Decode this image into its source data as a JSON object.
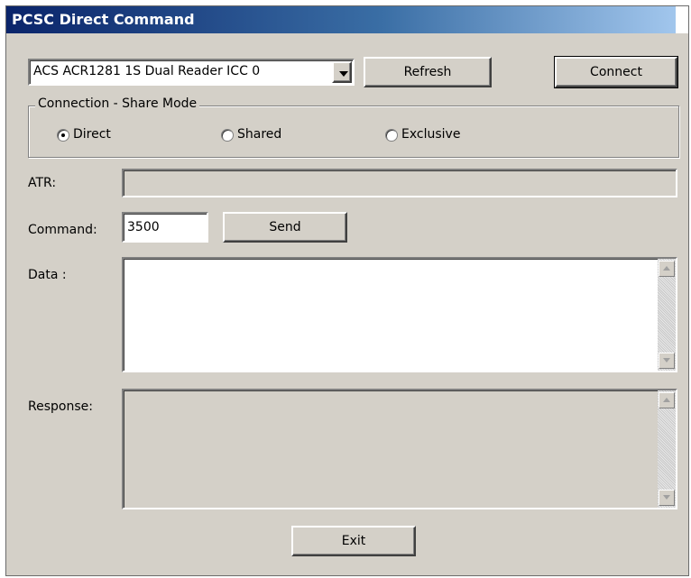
{
  "window": {
    "title": "PCSC Direct Command"
  },
  "reader": {
    "selected": "ACS ACR1281 1S Dual Reader ICC 0"
  },
  "buttons": {
    "refresh": "Refresh",
    "connect": "Connect",
    "send": "Send",
    "exit": "Exit"
  },
  "share_mode": {
    "legend": "Connection - Share Mode",
    "options": [
      {
        "label": "Direct",
        "selected": true
      },
      {
        "label": "Shared",
        "selected": false
      },
      {
        "label": "Exclusive",
        "selected": false
      }
    ]
  },
  "atr": {
    "label": "ATR:",
    "value": ""
  },
  "command": {
    "label": "Command:",
    "value": "3500"
  },
  "data": {
    "label": "Data :",
    "value": ""
  },
  "response": {
    "label": "Response:",
    "value": ""
  },
  "colors": {
    "face": "#d4d0c8",
    "title_start": "#0a246a",
    "title_end": "#a6caf0"
  }
}
